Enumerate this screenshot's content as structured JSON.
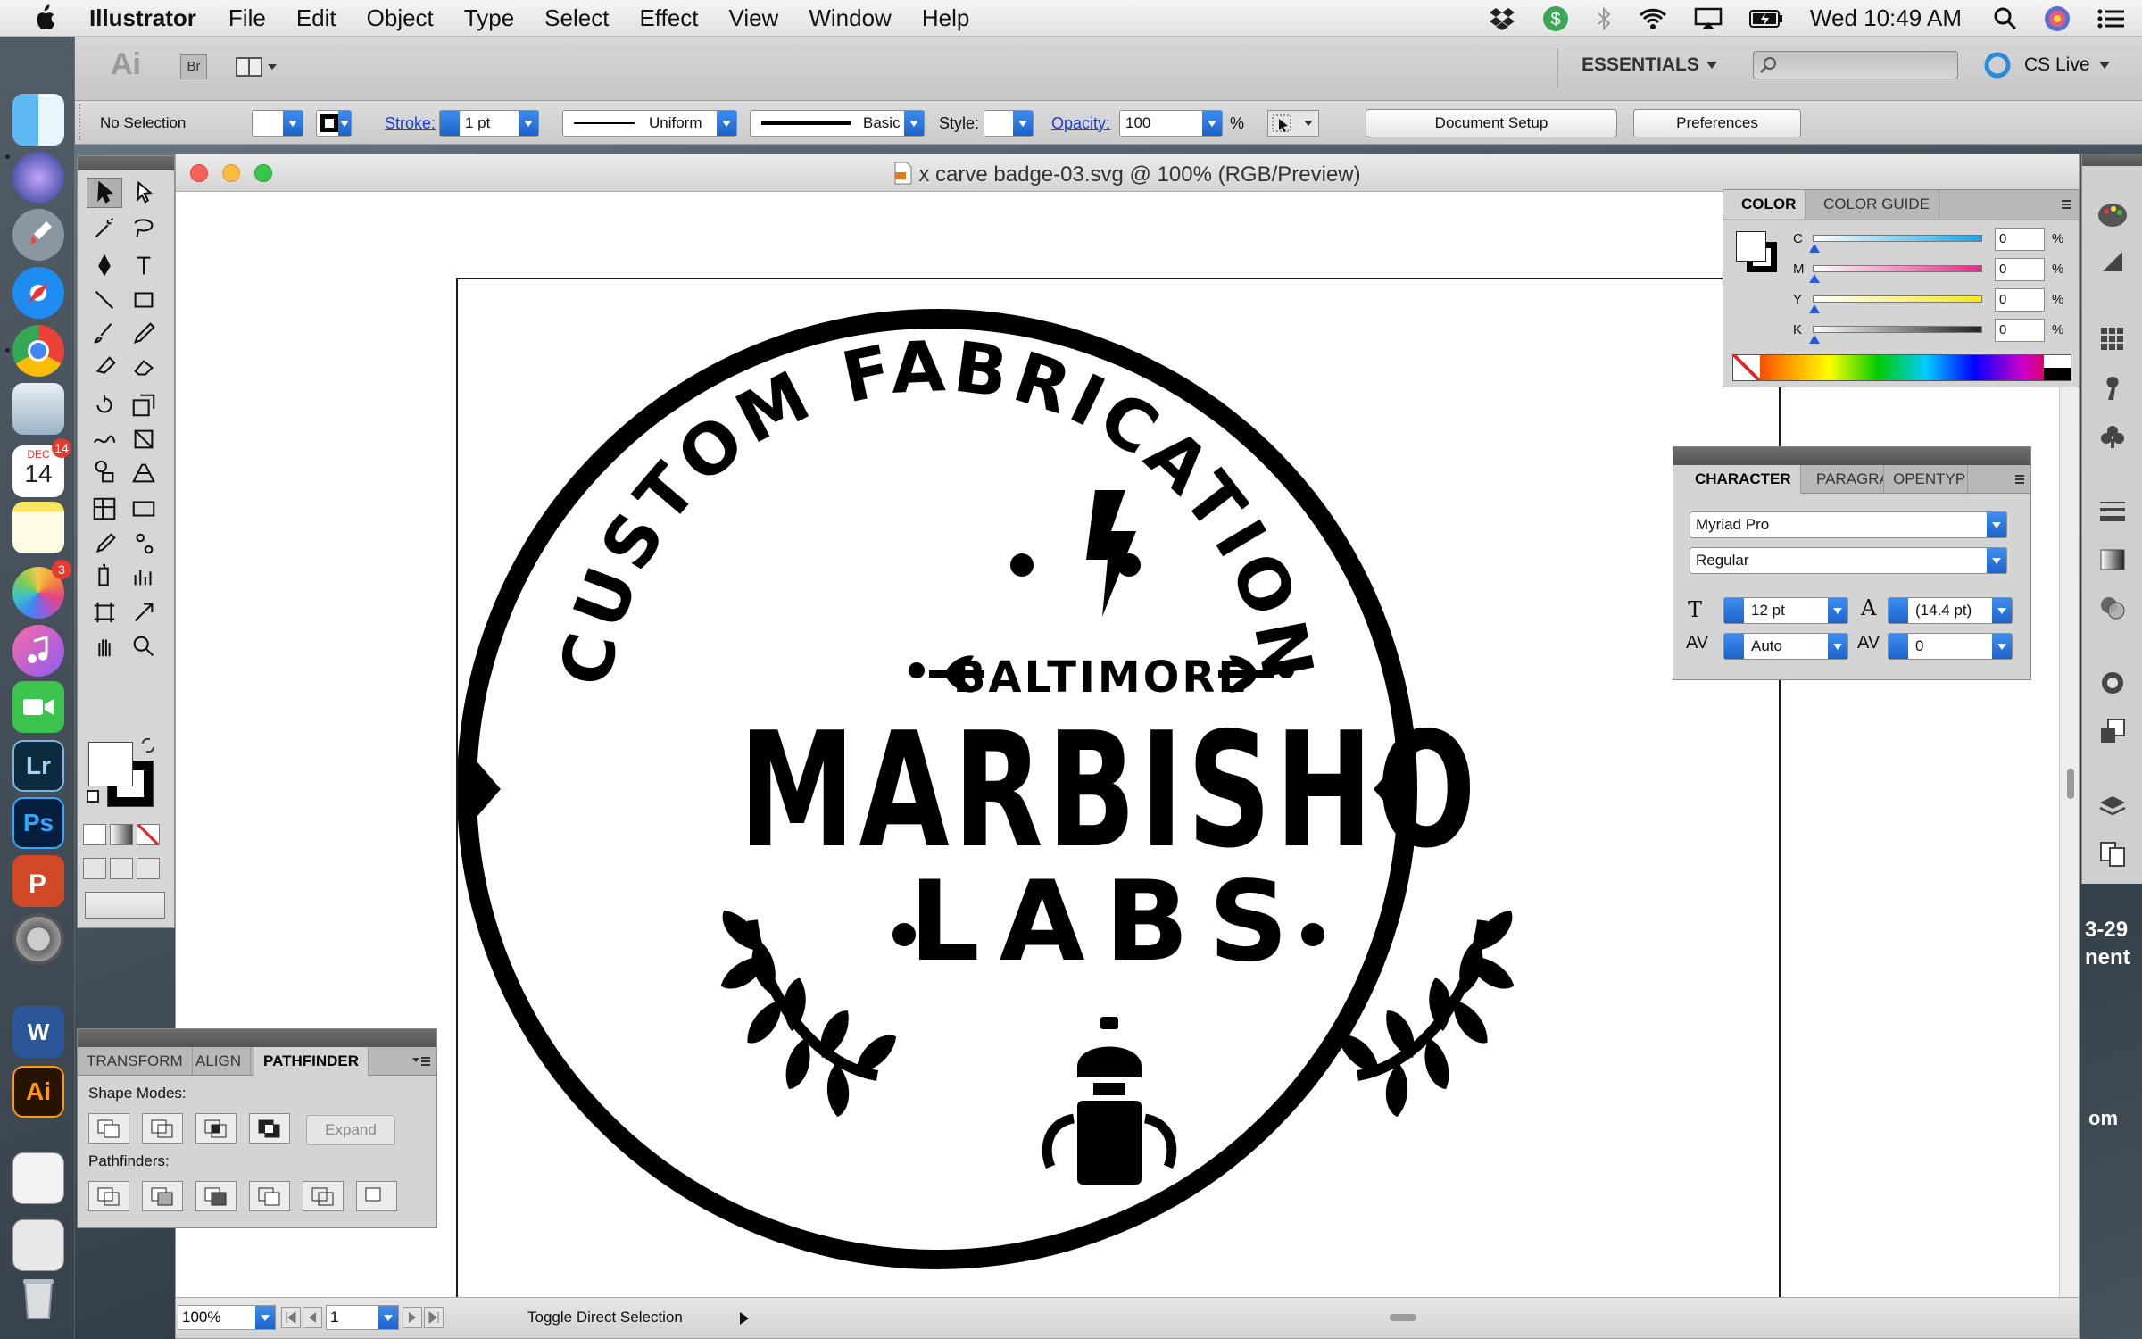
{
  "menubar": {
    "app_name": "Illustrator",
    "items": [
      "File",
      "Edit",
      "Object",
      "Type",
      "Select",
      "Effect",
      "View",
      "Window",
      "Help"
    ],
    "clock": "Wed 10:49 AM"
  },
  "dock": {
    "calendar_month": "DEC",
    "calendar_day": "14",
    "calendar_badge": "14",
    "photos_badge": "3",
    "lightroom_label": "Lr",
    "photoshop_label": "Ps",
    "illustrator_label": "Ai",
    "word_label": "W"
  },
  "app_bar": {
    "ai_logo": "Ai",
    "bridge_label": "Br",
    "workspace": "ESSENTIALS",
    "cs_live": "CS Live"
  },
  "control_bar": {
    "selection_status": "No Selection",
    "stroke_label": "Stroke:",
    "stroke_weight": "1 pt",
    "profile_uniform": "Uniform",
    "brush_basic": "Basic",
    "style_label": "Style:",
    "opacity_label": "Opacity:",
    "opacity_value": "100",
    "opacity_unit": "%",
    "document_setup": "Document Setup",
    "preferences": "Preferences"
  },
  "document": {
    "title": "x carve badge-03.svg @ 100% (RGB/Preview)",
    "zoom": "100%",
    "artboard_number": "1",
    "status_text": "Toggle Direct Selection"
  },
  "artwork": {
    "arc_text": "CUSTOM FABRICATION",
    "city": "BALTIMORE",
    "name": "MARBISHO",
    "labs": "LABS"
  },
  "color_panel": {
    "tabs": [
      "COLOR",
      "COLOR GUIDE"
    ],
    "channels": [
      {
        "label": "C",
        "value": "0",
        "unit": "%",
        "color": "#1aa5e6"
      },
      {
        "label": "M",
        "value": "0",
        "unit": "%",
        "color": "#e6278b"
      },
      {
        "label": "Y",
        "value": "0",
        "unit": "%",
        "color": "#f5e81a"
      },
      {
        "label": "K",
        "value": "0",
        "unit": "%",
        "color": "#222222"
      }
    ]
  },
  "character_panel": {
    "tabs": [
      "CHARACTER",
      "PARAGRA",
      "OPENTYP"
    ],
    "font_family": "Myriad Pro",
    "font_style": "Regular",
    "font_size": "12 pt",
    "leading": "(14.4 pt)",
    "kerning": "Auto",
    "tracking": "0"
  },
  "pathfinder_panel": {
    "tabs": [
      "TRANSFORM",
      "ALIGN",
      "PATHFINDER"
    ],
    "shape_modes_label": "Shape Modes:",
    "expand_label": "Expand",
    "pathfinders_label": "Pathfinders:"
  },
  "desktop": {
    "right_text": "3-29\nnent",
    "right_text2": "om"
  }
}
